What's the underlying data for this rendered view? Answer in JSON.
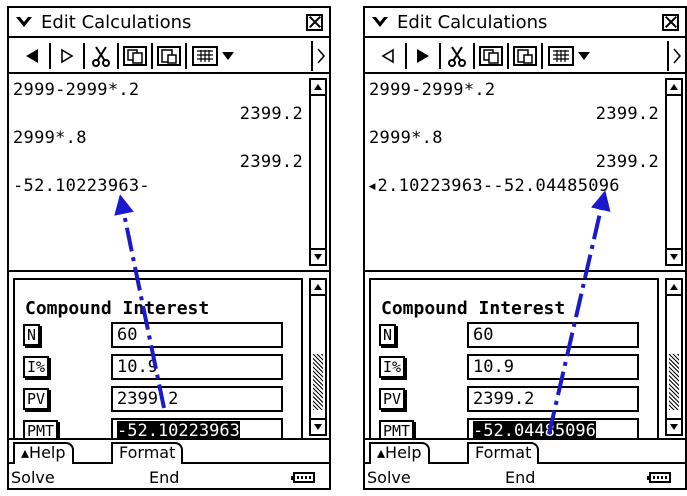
{
  "screens": [
    {
      "title": "Edit Calculations",
      "calc_lines": [
        {
          "text": "2999-2999*.2",
          "align": "left"
        },
        {
          "text": "2399.2",
          "align": "right"
        },
        {
          "text": "2999*.8",
          "align": "left"
        },
        {
          "text": "2399.2",
          "align": "right"
        },
        {
          "text": "-52.10223963-",
          "align": "left"
        }
      ],
      "form_title": "Compound Interest",
      "fields": [
        {
          "label": "N",
          "value": "60"
        },
        {
          "label": "I%",
          "value": "10.9"
        },
        {
          "label": "PV",
          "value": "2399.2"
        },
        {
          "label": "PMT",
          "value": "-52.10223963"
        }
      ],
      "tabs": [
        "▴Help",
        "Format"
      ],
      "status": {
        "left": "Solve",
        "middle": "End"
      },
      "arrow_color": "#1a1acc"
    },
    {
      "title": "Edit Calculations",
      "calc_lines": [
        {
          "text": "2999-2999*.2",
          "align": "left"
        },
        {
          "text": "2399.2",
          "align": "right"
        },
        {
          "text": "2999*.8",
          "align": "left"
        },
        {
          "text": "2399.2",
          "align": "right"
        },
        {
          "text": "◂2.10223963--52.04485096",
          "align": "left"
        }
      ],
      "form_title": "Compound Interest",
      "fields": [
        {
          "label": "N",
          "value": "60"
        },
        {
          "label": "I%",
          "value": "10.9"
        },
        {
          "label": "PV",
          "value": "2399.2"
        },
        {
          "label": "PMT",
          "value": "-52.04485096"
        }
      ],
      "tabs": [
        "▴Help",
        "Format"
      ],
      "status": {
        "left": "Solve",
        "middle": "End"
      },
      "arrow_color": "#1a1acc"
    }
  ],
  "icons": {
    "menu": "menu-down-arrow-icon",
    "close": "close-icon",
    "back": "back-arrow-icon",
    "forward": "forward-arrow-icon",
    "cut": "cut-icon",
    "copy": "copy-icon",
    "paste": "paste-icon",
    "keypad": "keypad-icon",
    "more": "more-arrow-icon",
    "battery": "battery-icon"
  }
}
